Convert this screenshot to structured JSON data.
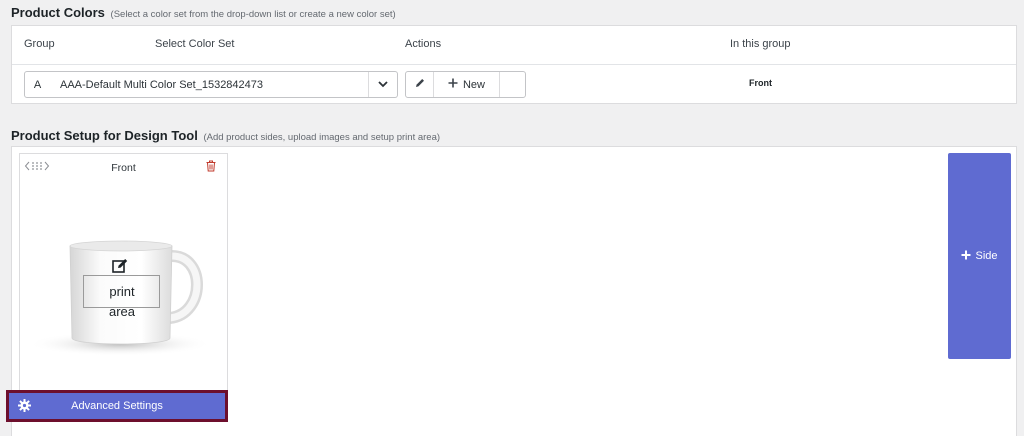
{
  "product_colors": {
    "title": "Product Colors",
    "hint": "(Select a color set from the drop-down list or create a new color set)",
    "columns": {
      "group": "Group",
      "select_color_set": "Select Color Set",
      "actions": "Actions",
      "in_this_group": "In this group"
    },
    "row": {
      "group": "A",
      "color_set": "AAA-Default Multi Color Set_1532842473",
      "new_label": "New",
      "in_this_group": "Front"
    }
  },
  "product_setup": {
    "title": "Product Setup for Design Tool",
    "hint": "(Add product sides, upload images and setup print area)",
    "sides": [
      {
        "name": "Front",
        "print_area_line1": "print",
        "print_area_line2": "area",
        "advanced_label": "Advanced Settings"
      }
    ],
    "add_side_label": "Side"
  },
  "icons": {
    "group_select_chevron": "chevron-down-icon",
    "edit": "pencil-icon",
    "new": "plus-icon",
    "drag": "drag-handle-icon",
    "delete": "trash-icon",
    "print_area_edit": "edit-square-icon",
    "advanced": "gear-icon",
    "add_side": "plus-icon"
  },
  "colors": {
    "accent": "#5f6bd1",
    "highlight_border": "#6d0f2d",
    "trash": "#c0392b"
  }
}
